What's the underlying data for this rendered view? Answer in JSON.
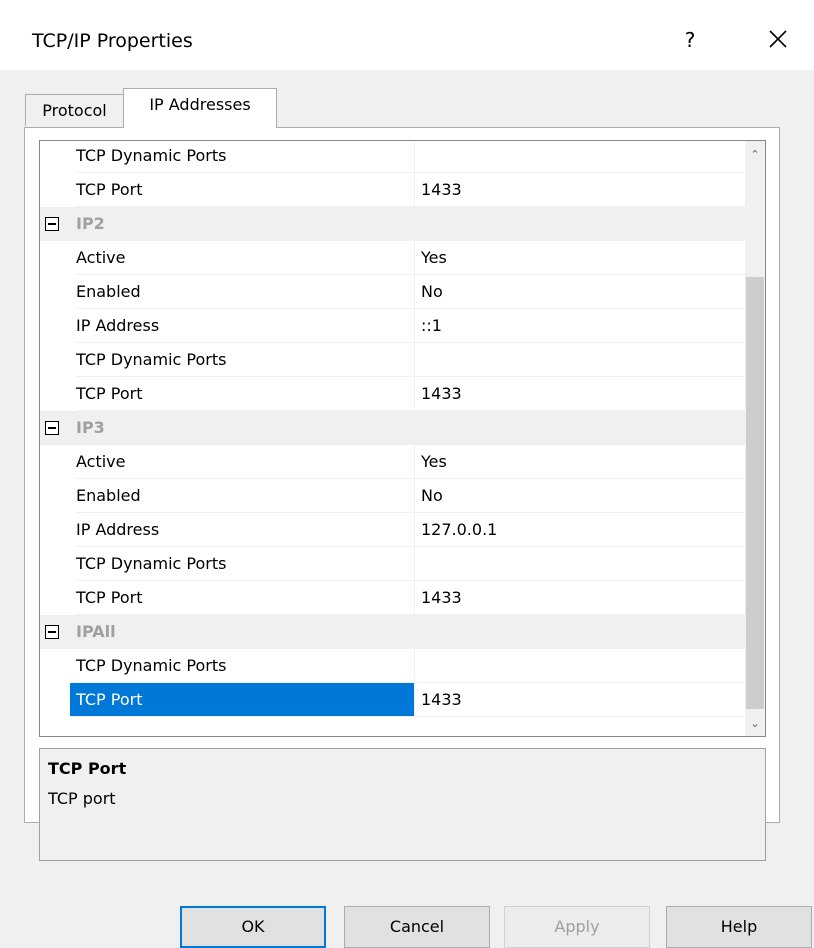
{
  "window": {
    "title": "TCP/IP Properties",
    "help_glyph": "?"
  },
  "tabs": [
    {
      "label": "Protocol",
      "active": false
    },
    {
      "label": "IP Addresses",
      "active": true
    }
  ],
  "grid": {
    "rows": [
      {
        "type": "property",
        "name": "TCP Dynamic Ports",
        "value": ""
      },
      {
        "type": "property",
        "name": "TCP Port",
        "value": "1433"
      },
      {
        "type": "category",
        "name": "IP2"
      },
      {
        "type": "property",
        "name": "Active",
        "value": "Yes"
      },
      {
        "type": "property",
        "name": "Enabled",
        "value": "No"
      },
      {
        "type": "property",
        "name": "IP Address",
        "value": "::1"
      },
      {
        "type": "property",
        "name": "TCP Dynamic Ports",
        "value": ""
      },
      {
        "type": "property",
        "name": "TCP Port",
        "value": "1433"
      },
      {
        "type": "category",
        "name": "IP3"
      },
      {
        "type": "property",
        "name": "Active",
        "value": "Yes"
      },
      {
        "type": "property",
        "name": "Enabled",
        "value": "No"
      },
      {
        "type": "property",
        "name": "IP Address",
        "value": "127.0.0.1"
      },
      {
        "type": "property",
        "name": "TCP Dynamic Ports",
        "value": ""
      },
      {
        "type": "property",
        "name": "TCP Port",
        "value": "1433"
      },
      {
        "type": "category",
        "name": "IPAll"
      },
      {
        "type": "property",
        "name": "TCP Dynamic Ports",
        "value": ""
      },
      {
        "type": "property",
        "name": "TCP Port",
        "value": "1433",
        "selected": true
      }
    ],
    "scroll_up_glyph": "⌃",
    "scroll_down_glyph": "⌄"
  },
  "description": {
    "title": "TCP Port",
    "text": "TCP port"
  },
  "buttons": {
    "ok": "OK",
    "cancel": "Cancel",
    "apply": "Apply",
    "help": "Help"
  },
  "colors": {
    "selection": "#0078d7",
    "category_text": "#a0a0a0"
  }
}
